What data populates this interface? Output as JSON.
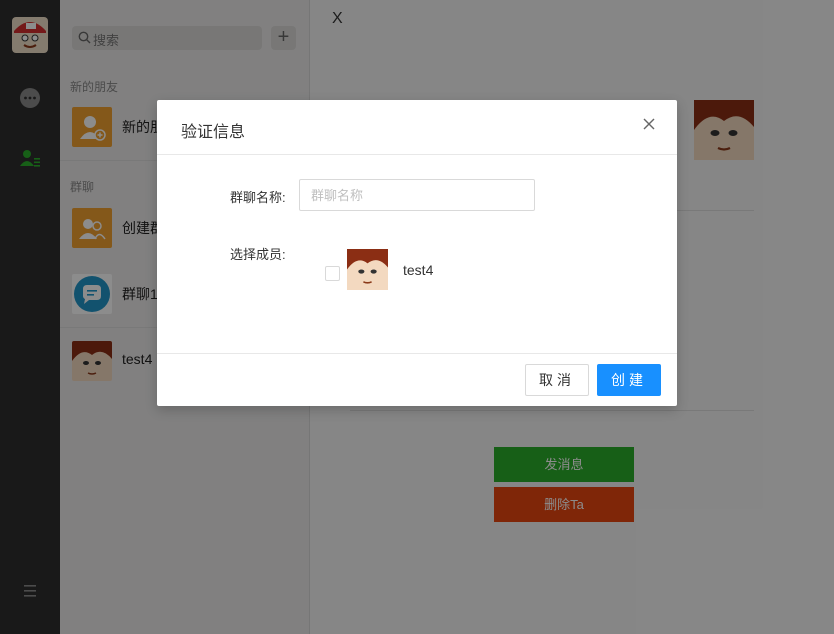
{
  "sidebar": {
    "icons": [
      "user-avatar",
      "chat-bubble-icon",
      "contacts-icon",
      "menu-icon"
    ],
    "active_color": "#2aad2a"
  },
  "contacts": {
    "search_placeholder": "搜索",
    "add_label": "+",
    "section_new_friends": "新的朋友",
    "section_groups": "群聊",
    "items": [
      {
        "name": "新的朋友",
        "icon": "add-friend-icon"
      },
      {
        "name": "创建群聊",
        "icon": "create-group-icon"
      },
      {
        "name": "群聊1",
        "icon": "group-chat-icon"
      },
      {
        "name": "test4",
        "icon": "user-avatar"
      }
    ]
  },
  "detail": {
    "close_label": "X",
    "send_message_label": "发消息",
    "delete_label": "删除Ta",
    "send_color": "#2aad2a",
    "delete_color": "#e8450f"
  },
  "modal": {
    "title": "验证信息",
    "group_name_label": "群聊名称:",
    "group_name_placeholder": "群聊名称",
    "group_name_value": "",
    "members_label": "选择成员:",
    "members": [
      {
        "name": "test4",
        "checked": false
      }
    ],
    "cancel_label": "取消",
    "create_label": "创建",
    "primary_color": "#1890ff"
  }
}
